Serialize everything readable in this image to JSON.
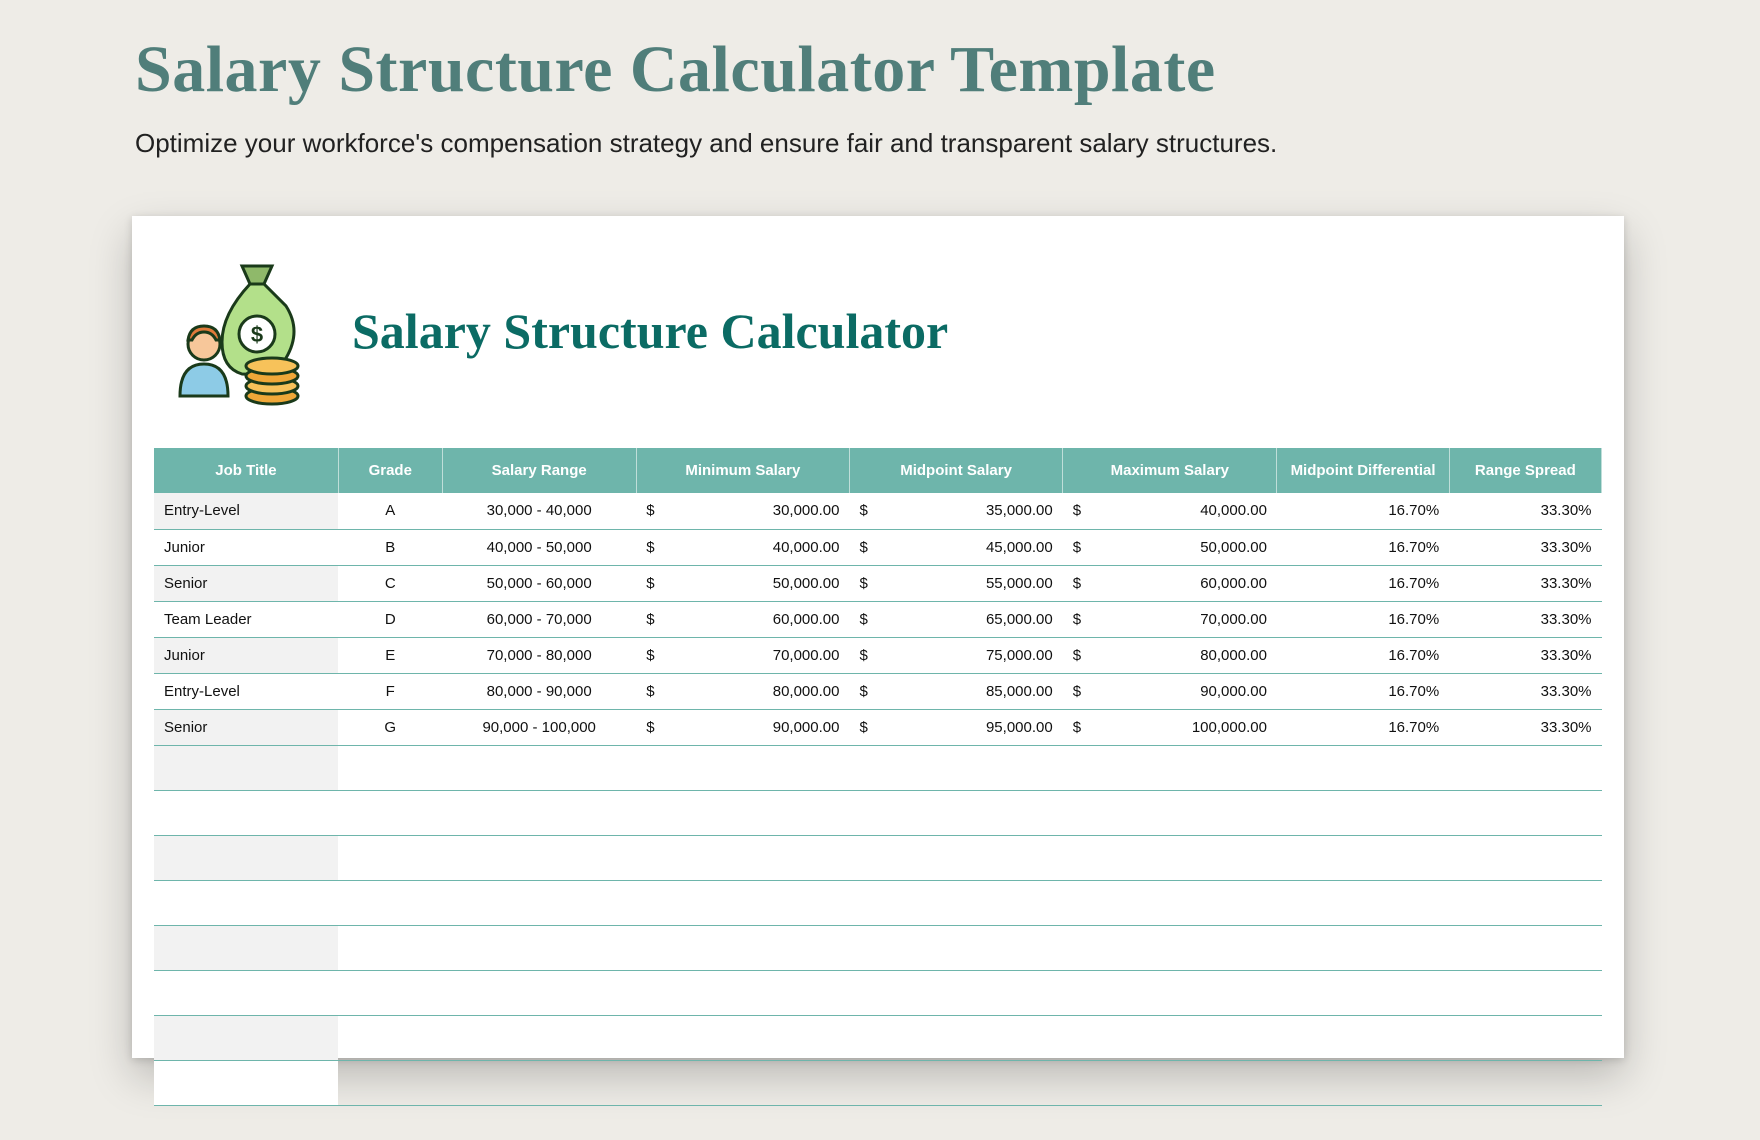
{
  "header": {
    "title": "Salary Structure Calculator Template",
    "subtitle": "Optimize your workforce's compensation strategy and ensure fair and transparent salary structures."
  },
  "card": {
    "title": "Salary Structure Calculator",
    "icon_label": "money-bag-person-coins-icon"
  },
  "table": {
    "columns": [
      "Job Title",
      "Grade",
      "Salary Range",
      "Minimum Salary",
      "Midpoint Salary",
      "Maximum Salary",
      "Midpoint Differential",
      "Range Spread"
    ],
    "rows": [
      {
        "job": "Entry-Level",
        "grade": "A",
        "range": "30,000 - 40,000",
        "min": "30,000.00",
        "mid": "35,000.00",
        "max": "40,000.00",
        "diff": "16.70%",
        "spread": "33.30%"
      },
      {
        "job": "Junior",
        "grade": "B",
        "range": "40,000 - 50,000",
        "min": "40,000.00",
        "mid": "45,000.00",
        "max": "50,000.00",
        "diff": "16.70%",
        "spread": "33.30%"
      },
      {
        "job": "Senior",
        "grade": "C",
        "range": "50,000 - 60,000",
        "min": "50,000.00",
        "mid": "55,000.00",
        "max": "60,000.00",
        "diff": "16.70%",
        "spread": "33.30%"
      },
      {
        "job": "Team Leader",
        "grade": "D",
        "range": "60,000 - 70,000",
        "min": "60,000.00",
        "mid": "65,000.00",
        "max": "70,000.00",
        "diff": "16.70%",
        "spread": "33.30%"
      },
      {
        "job": "Junior",
        "grade": "E",
        "range": "70,000 - 80,000",
        "min": "70,000.00",
        "mid": "75,000.00",
        "max": "80,000.00",
        "diff": "16.70%",
        "spread": "33.30%"
      },
      {
        "job": "Entry-Level",
        "grade": "F",
        "range": "80,000 - 90,000",
        "min": "80,000.00",
        "mid": "85,000.00",
        "max": "90,000.00",
        "diff": "16.70%",
        "spread": "33.30%"
      },
      {
        "job": "Senior",
        "grade": "G",
        "range": "90,000 - 100,000",
        "min": "90,000.00",
        "mid": "95,000.00",
        "max": "100,000.00",
        "diff": "16.70%",
        "spread": "33.30%"
      }
    ],
    "empty_rows": 8,
    "currency_symbol": "$"
  }
}
